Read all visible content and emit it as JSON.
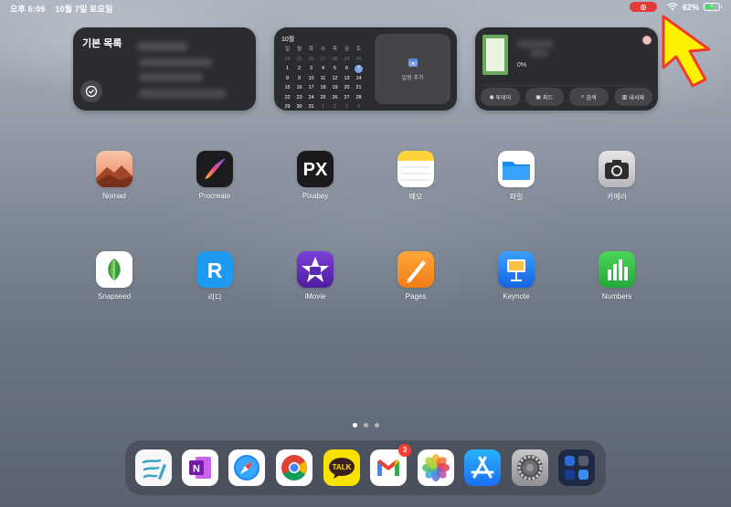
{
  "status": {
    "time": "오후 6:09",
    "date": "10월 7일 토요일",
    "battery": "62%",
    "battery_level": 0.62,
    "recording_color": "#e33a3a"
  },
  "widgets": {
    "reminders": {
      "title": "기본 목록"
    },
    "calendar": {
      "month": "10월",
      "weekdays": [
        "일",
        "월",
        "화",
        "수",
        "목",
        "금",
        "토"
      ],
      "weeks": [
        [
          "24",
          "25",
          "26",
          "27",
          "28",
          "29",
          "30"
        ],
        [
          "1",
          "2",
          "3",
          "4",
          "5",
          "6",
          "7"
        ],
        [
          "8",
          "9",
          "10",
          "11",
          "12",
          "13",
          "14"
        ],
        [
          "15",
          "16",
          "17",
          "18",
          "19",
          "20",
          "21"
        ],
        [
          "22",
          "23",
          "24",
          "25",
          "26",
          "27",
          "28"
        ],
        [
          "29",
          "30",
          "31",
          "1",
          "2",
          "3",
          "4"
        ]
      ],
      "today": "7",
      "add_label": "일정 추가"
    },
    "books": {
      "progress": "0%",
      "buttons": [
        "투데이",
        "피드",
        "검색",
        "내서재"
      ]
    }
  },
  "apps": [
    {
      "label": "Nomad"
    },
    {
      "label": "Procreate"
    },
    {
      "label": "Pixabay"
    },
    {
      "label": "메모"
    },
    {
      "label": "파일"
    },
    {
      "label": "카메라"
    },
    {
      "label": "Snapseed"
    },
    {
      "label": "리디"
    },
    {
      "label": "iMovie"
    },
    {
      "label": "Pages"
    },
    {
      "label": "Keynote"
    },
    {
      "label": "Numbers"
    }
  ],
  "dock": {
    "gmail_badge": "3"
  },
  "page_indicator": {
    "pages": 3,
    "current": 1
  }
}
